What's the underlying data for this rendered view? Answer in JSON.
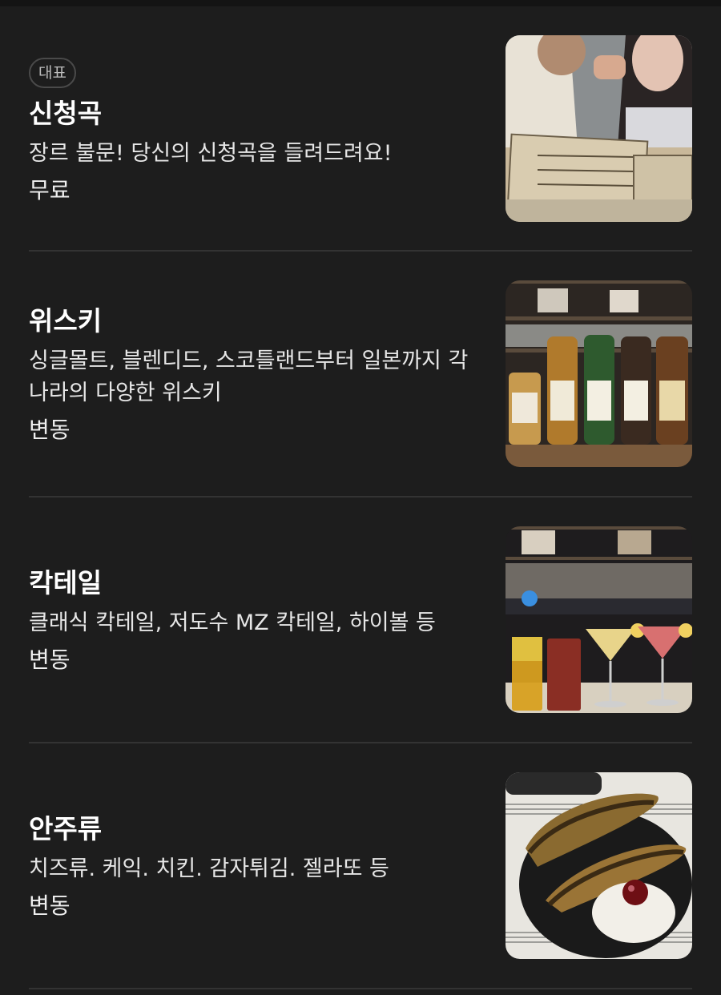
{
  "menu": {
    "items": [
      {
        "badge": "대표",
        "name": "신청곡",
        "desc": "장르 불문! 당신의 신청곡을 들려드려요!",
        "price": "무료",
        "image_icon": "album-cover-photo"
      },
      {
        "name": "위스키",
        "desc": "싱글몰트, 블렌디드, 스코틀랜드부터 일본까지 각 나라의 다양한 위스키",
        "price": "변동",
        "image_icon": "whisky-bottles-photo"
      },
      {
        "name": "칵테일",
        "desc": "클래식 칵테일, 저도수 MZ 칵테일, 하이볼 등",
        "price": "변동",
        "image_icon": "cocktails-photo"
      },
      {
        "name": "안주류",
        "desc": "치즈류. 케익. 치킨. 감자튀김. 젤라또 등",
        "price": "변동",
        "image_icon": "banana-dessert-photo"
      }
    ]
  },
  "colors": {
    "background": "#1d1d1d",
    "divider": "#333333",
    "text": "#ffffff"
  }
}
